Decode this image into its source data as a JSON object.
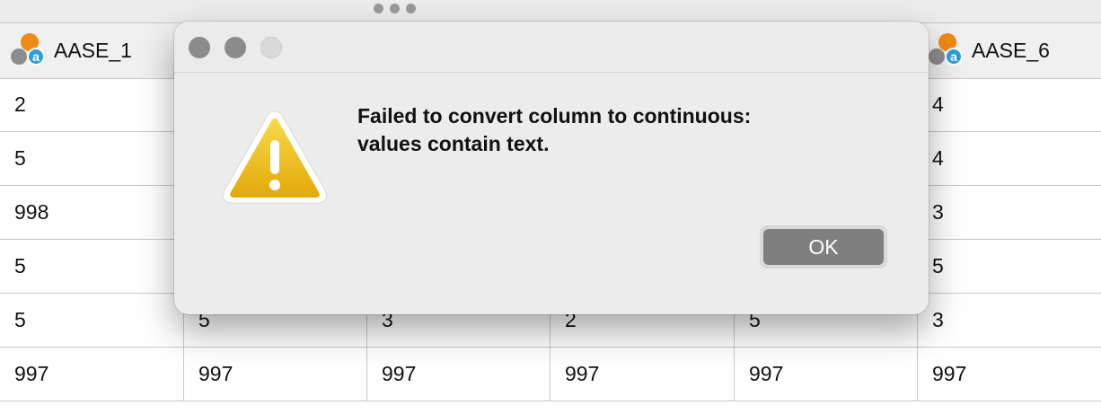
{
  "columns": [
    {
      "label": "AASE_1",
      "icon": "variable-type-icon"
    },
    {
      "label": "",
      "icon": ""
    },
    {
      "label": "",
      "icon": ""
    },
    {
      "label": "",
      "icon": ""
    },
    {
      "label": "",
      "icon": ""
    },
    {
      "label": "AASE_6",
      "icon": "variable-type-icon"
    }
  ],
  "rows": [
    [
      "2",
      "",
      "",
      "",
      "",
      "4"
    ],
    [
      "5",
      "",
      "",
      "",
      "",
      "4"
    ],
    [
      "998",
      "",
      "",
      "",
      "",
      "3"
    ],
    [
      "5",
      "",
      "",
      "",
      "",
      "5"
    ],
    [
      "5",
      "5",
      "3",
      "2",
      "5",
      "3"
    ],
    [
      "997",
      "997",
      "997",
      "997",
      "997",
      "997"
    ]
  ],
  "dialog": {
    "message_line1": "Failed to convert column to continuous:",
    "message_line2": "values contain text.",
    "ok_label": "OK",
    "icon": "warning-icon"
  },
  "colors": {
    "warning_yellow": "#f3c21b",
    "ok_button": "#7f7f7f",
    "dialog_bg": "#ececec"
  }
}
